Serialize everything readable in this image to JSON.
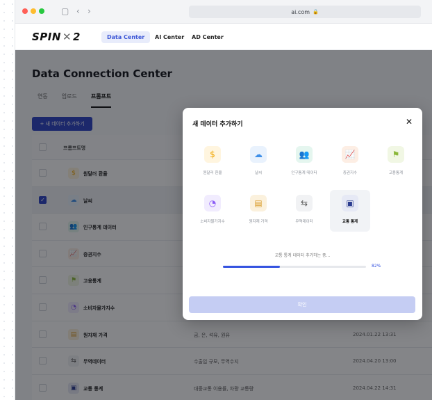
{
  "browser": {
    "url": "ai.com",
    "lock_icon": "lock-icon"
  },
  "nav": {
    "logo_left": "SPIN",
    "logo_x": "✕",
    "logo_right": "2",
    "tabs": [
      {
        "label": "Data Center",
        "active": true
      },
      {
        "label": "AI Center",
        "active": false
      },
      {
        "label": "AD Center",
        "active": false
      }
    ]
  },
  "page": {
    "title": "Data Connection Center",
    "subtabs": [
      {
        "label": "연동",
        "active": false
      },
      {
        "label": "업로드",
        "active": false
      },
      {
        "label": "프롬프트",
        "active": true
      }
    ],
    "add_button": "+ 새 데이터 추가하기"
  },
  "table": {
    "header": "프롬프트명",
    "rows": [
      {
        "name": "원달러 환율",
        "icon": "dollar-icon",
        "color": "#f0a500",
        "desc": "",
        "date": "",
        "checked": false
      },
      {
        "name": "날씨",
        "icon": "cloud-icon",
        "color": "#3f8fe8",
        "desc": "",
        "date": "",
        "checked": true
      },
      {
        "name": "인구통계 데이터",
        "icon": "people-icon",
        "color": "#2fb380",
        "desc": "",
        "date": "",
        "checked": false
      },
      {
        "name": "증권지수",
        "icon": "chart-icon",
        "color": "#e8834a",
        "desc": "",
        "date": "",
        "checked": false
      },
      {
        "name": "고용통계",
        "icon": "flag-icon",
        "color": "#8bb83a",
        "desc": "",
        "date": "",
        "checked": false
      },
      {
        "name": "소비자물가지수",
        "icon": "pie-icon",
        "color": "#8b5cf6",
        "desc": "",
        "date": "",
        "checked": false
      },
      {
        "name": "원자재 가격",
        "icon": "coins-icon",
        "color": "#d99b2b",
        "desc": "금, 은, 석유, 원유",
        "date": "2024.01.22 13:31",
        "checked": false
      },
      {
        "name": "무역데이터",
        "icon": "trade-icon",
        "color": "#555555",
        "desc": "수출입 규모, 무역수지",
        "date": "2024.04.20 13:00",
        "checked": false
      },
      {
        "name": "교통 통계",
        "icon": "bus-icon",
        "color": "#2a3b8f",
        "desc": "대중교통 이용률, 차량 교통량",
        "date": "2024.04.22 14:31",
        "checked": false
      }
    ]
  },
  "modal": {
    "title": "새 데이터 추가하기",
    "close_icon": "close-icon",
    "tiles": [
      {
        "label": "원달러 환율",
        "icon": "dollar-icon",
        "glyph": "$",
        "color": "#f0a500",
        "bg": "#fff5df",
        "selected": false
      },
      {
        "label": "날씨",
        "icon": "cloud-icon",
        "glyph": "☁",
        "color": "#3f8fe8",
        "bg": "#e9f2fd",
        "selected": false
      },
      {
        "label": "인구통계 데이터",
        "icon": "people-icon",
        "glyph": "👥",
        "color": "#2fb380",
        "bg": "#e5f6ef",
        "selected": false
      },
      {
        "label": "증권지수",
        "icon": "chart-icon",
        "glyph": "📈",
        "color": "#e8834a",
        "bg": "#fdeee4",
        "selected": false
      },
      {
        "label": "고용통계",
        "icon": "flag-icon",
        "glyph": "⚑",
        "color": "#8bb83a",
        "bg": "#f1f7e4",
        "selected": false
      },
      {
        "label": "소비자물가지수",
        "icon": "pie-icon",
        "glyph": "◔",
        "color": "#8b5cf6",
        "bg": "#f1ecfe",
        "selected": false
      },
      {
        "label": "원자재 가격",
        "icon": "coins-icon",
        "glyph": "▤",
        "color": "#d99b2b",
        "bg": "#fbf1dd",
        "selected": false
      },
      {
        "label": "무역데이터",
        "icon": "trade-icon",
        "glyph": "⇆",
        "color": "#555555",
        "bg": "#f1f2f4",
        "selected": false
      },
      {
        "label": "교통 통계",
        "icon": "bus-icon",
        "glyph": "▣",
        "color": "#2a3b8f",
        "bg": "#e6e9f5",
        "selected": true
      }
    ],
    "progress_label": "교통 통계 데이터 추가하는 중...",
    "progress_value": 0.4,
    "progress_text": "82%",
    "confirm_label": "확인"
  }
}
